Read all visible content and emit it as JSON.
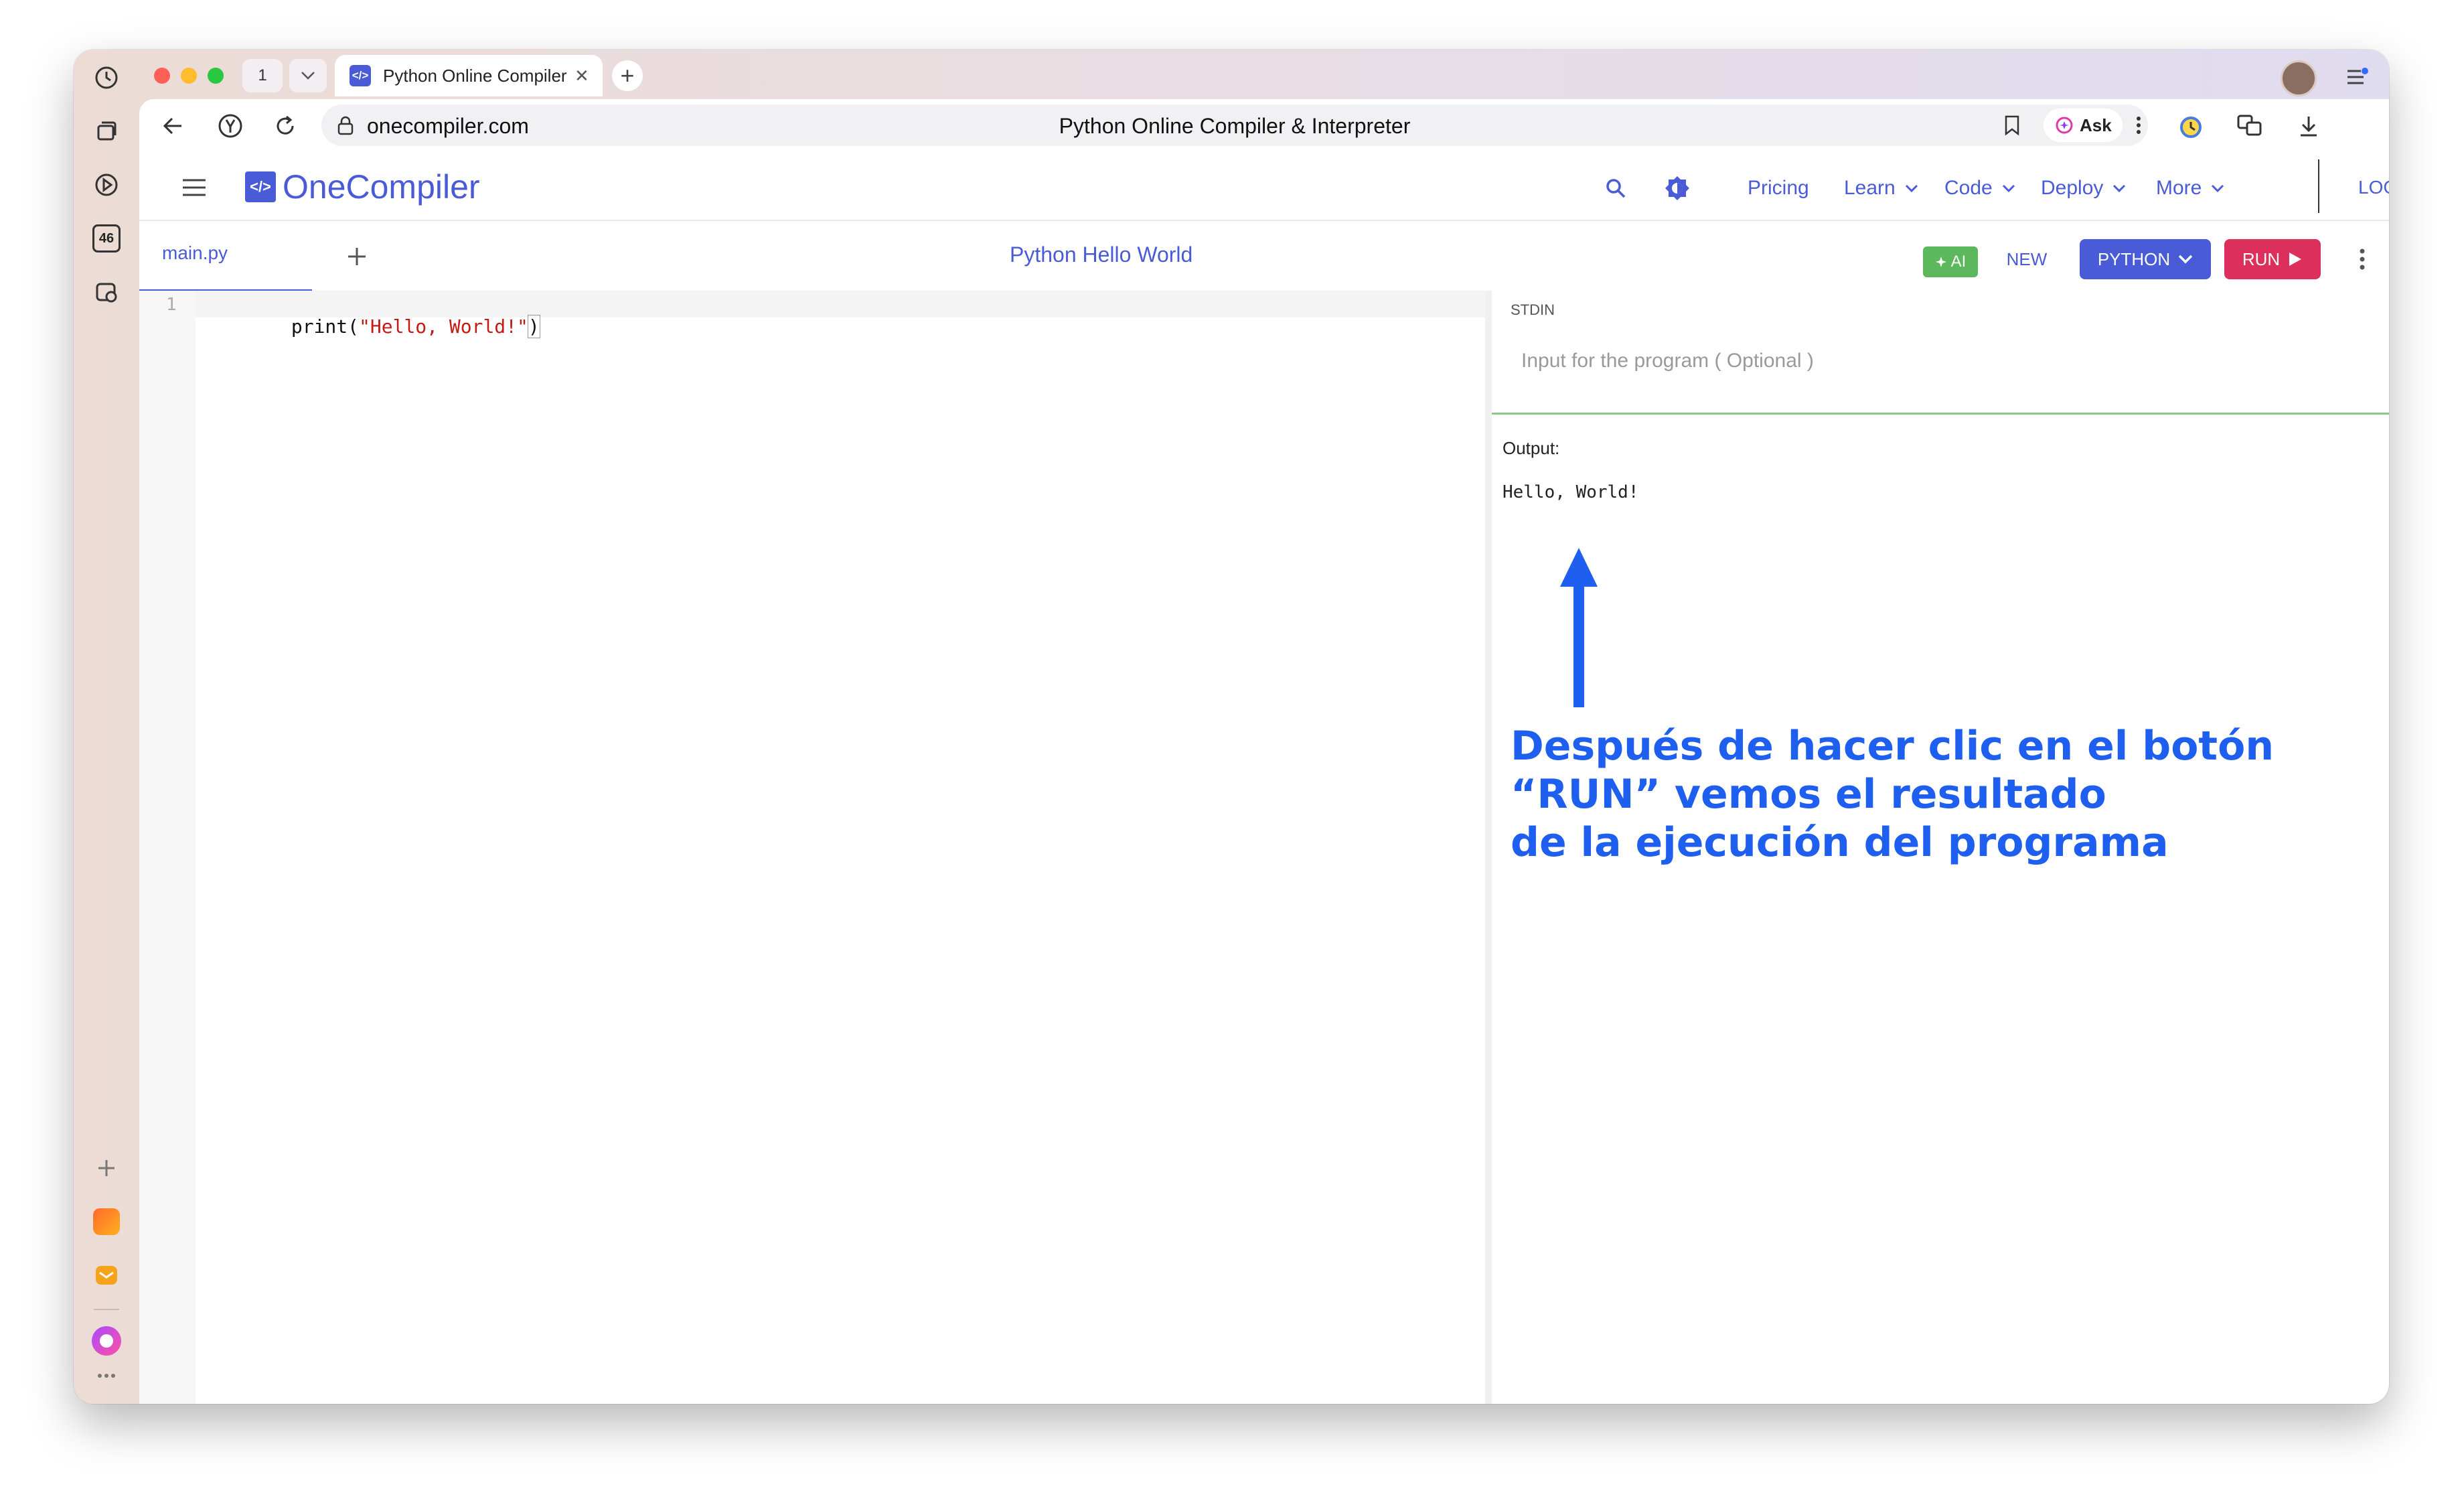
{
  "browser": {
    "tab_count": "1",
    "tab_title": "Python Online Compiler",
    "tab_favicon": "</>",
    "url": "onecompiler.com",
    "page_title": "Python Online Compiler & Interpreter",
    "ask_label": "Ask",
    "sidebar_badge": "46"
  },
  "app": {
    "logo_mark": "</>",
    "logo_text": "OneCompiler",
    "nav": {
      "pricing": "Pricing",
      "learn": "Learn",
      "code": "Code",
      "deploy": "Deploy",
      "more": "More",
      "login": "LOGIN"
    }
  },
  "toolbar": {
    "file_tab": "main.py",
    "title": "Python Hello World",
    "ai_label": "AI",
    "new_label": "NEW",
    "lang_label": "PYTHON",
    "run_label": "RUN"
  },
  "editor": {
    "line_number": "1",
    "code_fn": "print(",
    "code_str": "\"Hello, World!\"",
    "code_close": ")"
  },
  "io": {
    "stdin_label": "STDIN",
    "stdin_placeholder": "Input for the program ( Optional )",
    "output_label": "Output:",
    "output_text": "Hello, World!"
  },
  "annotation": {
    "line1": "Después de hacer clic en el botón",
    "line2": "“RUN” vemos el resultado",
    "line3": "de la ejecución del programa"
  },
  "colors": {
    "brand": "#4a5bd8",
    "run": "#dc2f5b",
    "ai": "#5cb85c",
    "annotation": "#1e5ff0"
  }
}
